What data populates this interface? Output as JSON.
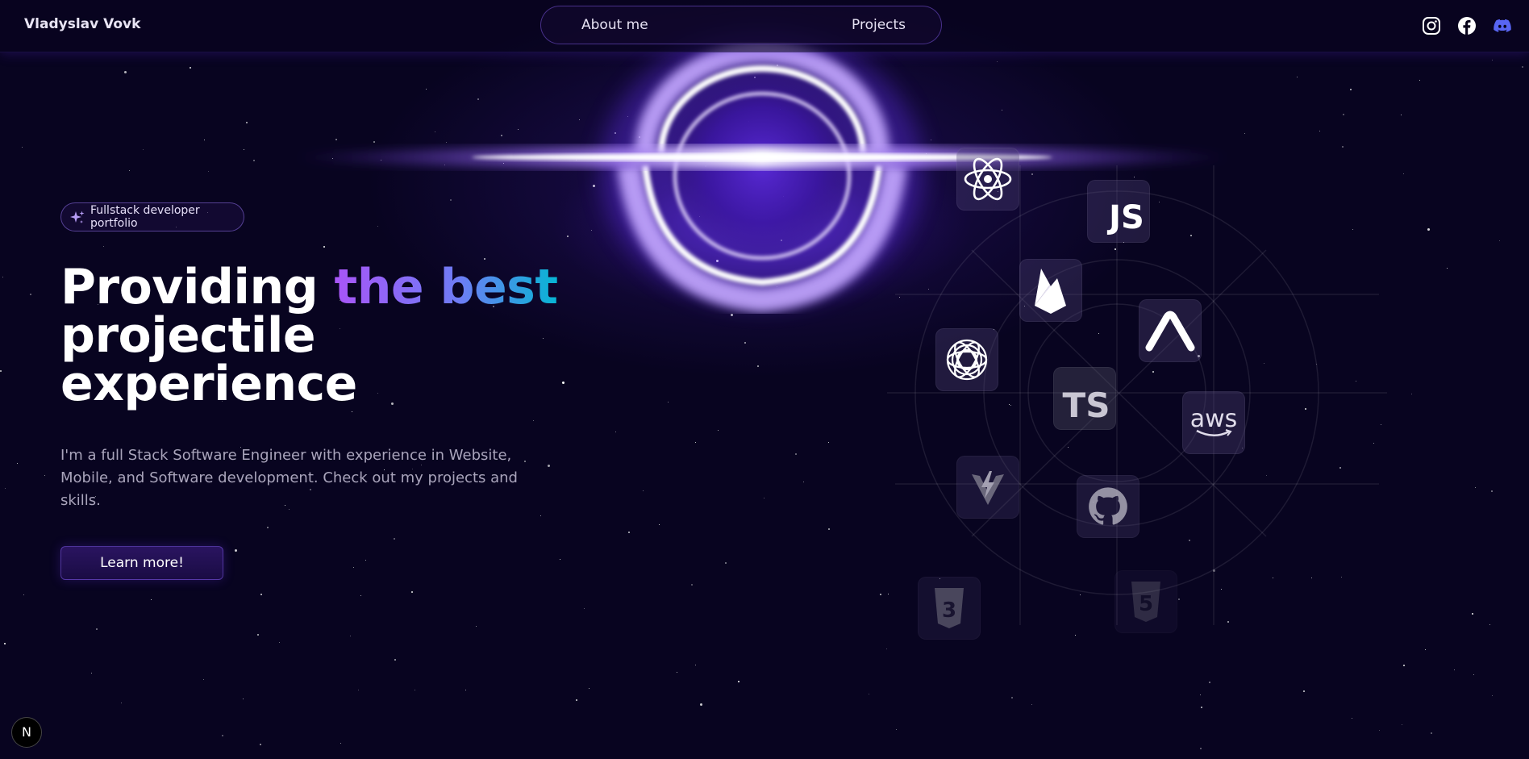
{
  "navbar": {
    "brand": "Vladyslav Vovk",
    "links": [
      "About me",
      "Projects"
    ],
    "social_icons": [
      "instagram-icon",
      "facebook-icon",
      "discord-icon"
    ]
  },
  "hero": {
    "badge": "Fullstack developer portfolio",
    "headline": {
      "part1": "Providing ",
      "highlight": "the best",
      "line2": "projectile",
      "line3": "experience"
    },
    "description": "I'm a full Stack Software Engineer with experience in Website, Mobile, and Software development. Check out my projects and skills.",
    "cta": "Learn more!"
  },
  "skills": {
    "icons": [
      "react-icon",
      "javascript-icon",
      "firebase-icon",
      "expo-icon",
      "openai-icon",
      "typescript-icon",
      "aws-icon",
      "vite-icon",
      "github-icon",
      "css3-icon",
      "html5-icon"
    ],
    "labels": {
      "js": "JS",
      "ts": "TS",
      "aws": "aws"
    }
  },
  "footer_badge": "N",
  "colors": {
    "background": "#080420",
    "accent": "#7b3cff",
    "gradient_start": "#a855f7",
    "gradient_end": "#06b6d4",
    "discord": "#5865f2"
  }
}
